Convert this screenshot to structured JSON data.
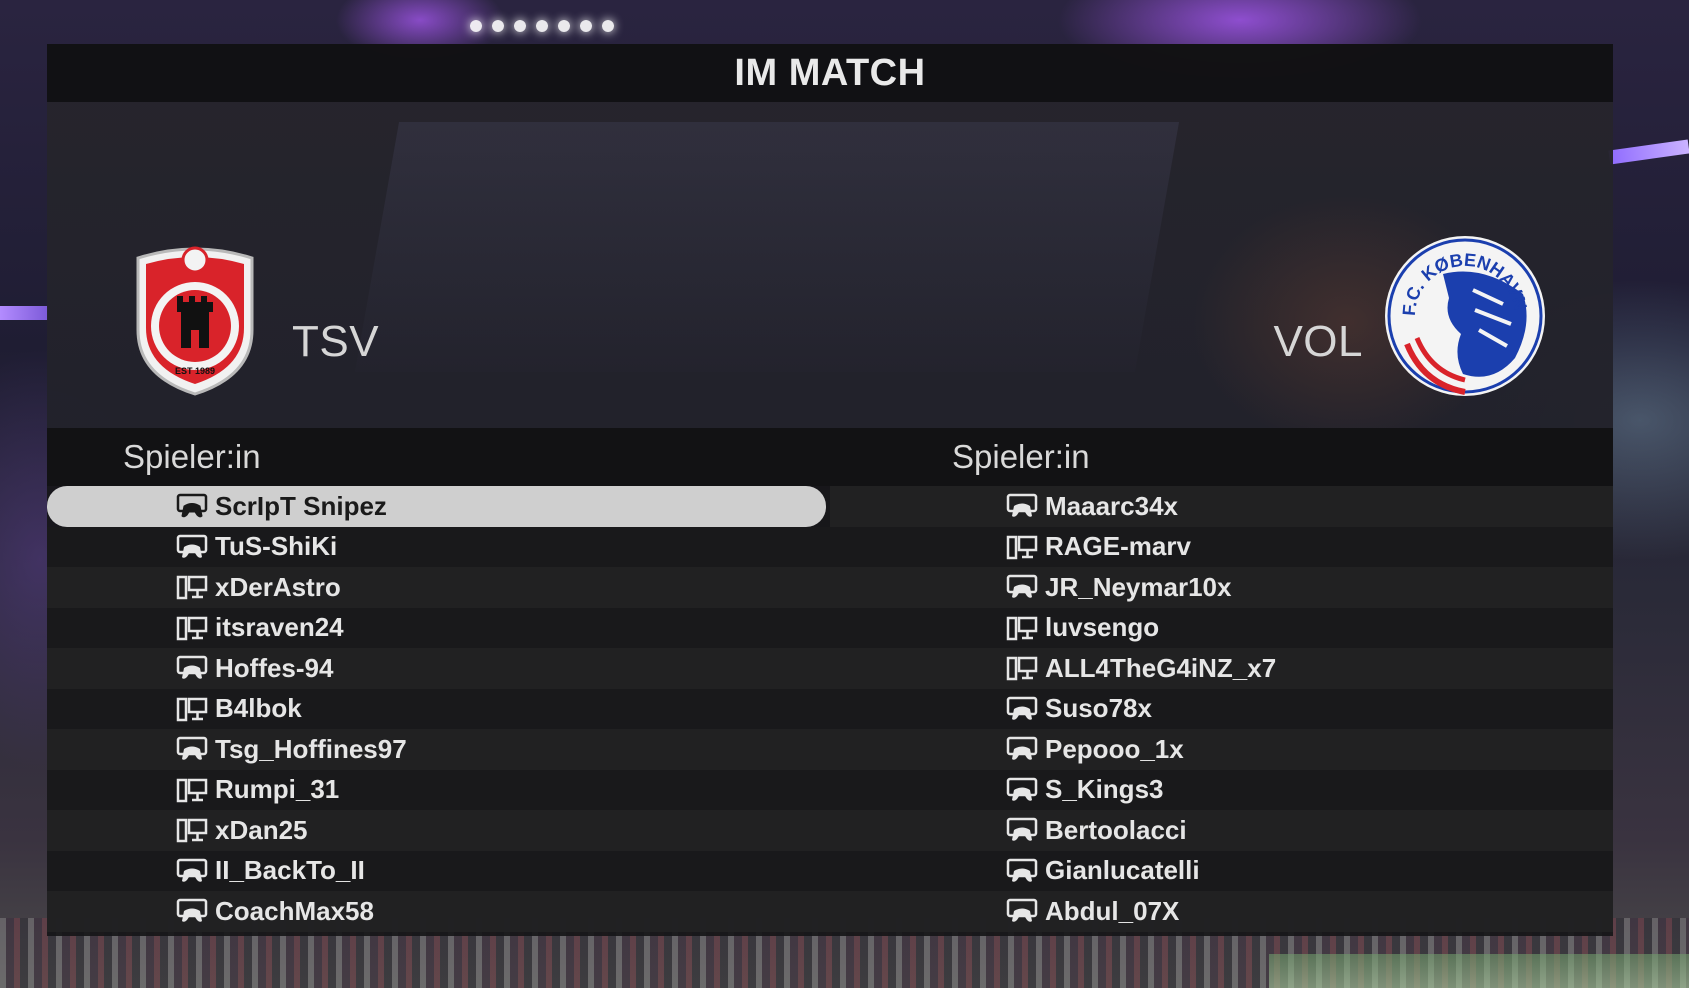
{
  "screen": {
    "title": "IM MATCH"
  },
  "home_team": {
    "abbr": "TSV",
    "crest_text": "EST 1989",
    "accent_color": "#d9232a",
    "players_header": "Spieler:in",
    "players": [
      {
        "name": "ScrIpT Snipez",
        "platform": "console-icon",
        "selected": true
      },
      {
        "name": "TuS-ShiKi",
        "platform": "console-icon",
        "selected": false
      },
      {
        "name": "xDerAstro",
        "platform": "pc-icon",
        "selected": false
      },
      {
        "name": "itsraven24",
        "platform": "pc-icon",
        "selected": false
      },
      {
        "name": "Hoffes-94",
        "platform": "console-icon",
        "selected": false
      },
      {
        "name": "B4lbok",
        "platform": "pc-icon",
        "selected": false
      },
      {
        "name": "Tsg_Hoffines97",
        "platform": "console-icon",
        "selected": false
      },
      {
        "name": "Rumpi_31",
        "platform": "pc-icon",
        "selected": false
      },
      {
        "name": "xDan25",
        "platform": "pc-icon",
        "selected": false
      },
      {
        "name": "II_BackTo_II",
        "platform": "console-icon",
        "selected": false
      },
      {
        "name": "CoachMax58",
        "platform": "console-icon",
        "selected": false
      }
    ]
  },
  "away_team": {
    "abbr": "VOL",
    "crest_text": "F.C. KØBENHAVN",
    "accent_color": "#1b3fae",
    "players_header": "Spieler:in",
    "players": [
      {
        "name": "Maaarc34x",
        "platform": "console-icon",
        "selected": false
      },
      {
        "name": "RAGE-marv",
        "platform": "pc-icon",
        "selected": false
      },
      {
        "name": "JR_Neymar10x",
        "platform": "console-icon",
        "selected": false
      },
      {
        "name": "luvsengo",
        "platform": "pc-icon",
        "selected": false
      },
      {
        "name": "ALL4TheG4iNZ_x7",
        "platform": "pc-icon",
        "selected": false
      },
      {
        "name": "Suso78x",
        "platform": "console-icon",
        "selected": false
      },
      {
        "name": "Pepooo_1x",
        "platform": "console-icon",
        "selected": false
      },
      {
        "name": "S_Kings3",
        "platform": "console-icon",
        "selected": false
      },
      {
        "name": "Bertoolacci",
        "platform": "console-icon",
        "selected": false
      },
      {
        "name": "Gianlucatelli",
        "platform": "console-icon",
        "selected": false
      },
      {
        "name": "Abdul_07X",
        "platform": "console-icon",
        "selected": false
      }
    ]
  }
}
